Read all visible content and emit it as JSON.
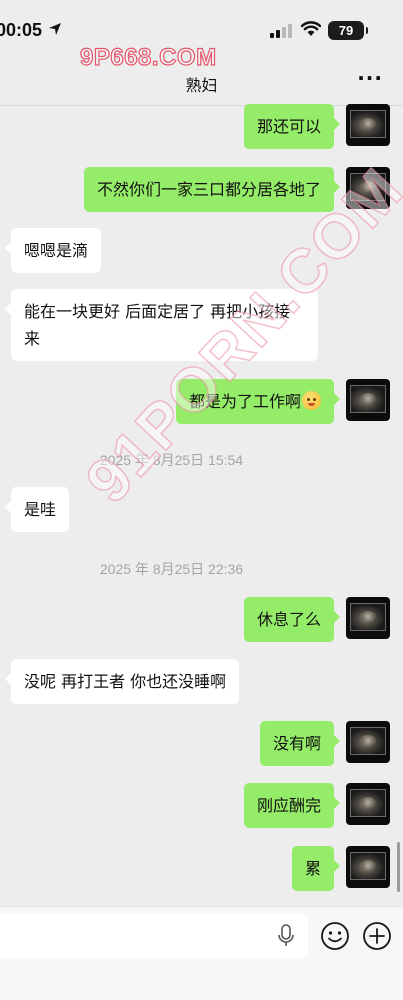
{
  "status_bar": {
    "time": "00:05",
    "battery": "79"
  },
  "watermarks": {
    "top": "9P668.COM",
    "diagonal": "91PORN.COM"
  },
  "header": {
    "title": "熟妇",
    "more_label": "···"
  },
  "messages": [
    {
      "side": "out",
      "text": "那还可以"
    },
    {
      "side": "out",
      "text": "不然你们一家三口都分居各地了"
    },
    {
      "side": "in",
      "text": "嗯嗯是滴"
    },
    {
      "side": "in",
      "text": "能在一块更好 后面定居了 再把小孩接来"
    },
    {
      "side": "out",
      "text": "都是为了工作啊",
      "emoji": "embarrassed-face"
    },
    {
      "type": "timestamp",
      "text": "2025 年 8月25日 15:54"
    },
    {
      "side": "in",
      "text": "是哇"
    },
    {
      "type": "timestamp",
      "text": "2025 年 8月25日 22:36"
    },
    {
      "side": "out",
      "text": "休息了么"
    },
    {
      "side": "in",
      "text": "没呢 再打王者 你也还没睡啊"
    },
    {
      "side": "out",
      "text": "没有啊"
    },
    {
      "side": "out",
      "text": "刚应酬完"
    },
    {
      "side": "out",
      "text": "累"
    }
  ],
  "input_bar": {
    "value": "",
    "icons": [
      "mic-icon",
      "emoji-icon",
      "plus-icon"
    ]
  },
  "colors": {
    "background": "#ededed",
    "outgoing_bubble": "#95ec69",
    "incoming_bubble": "#ffffff"
  }
}
